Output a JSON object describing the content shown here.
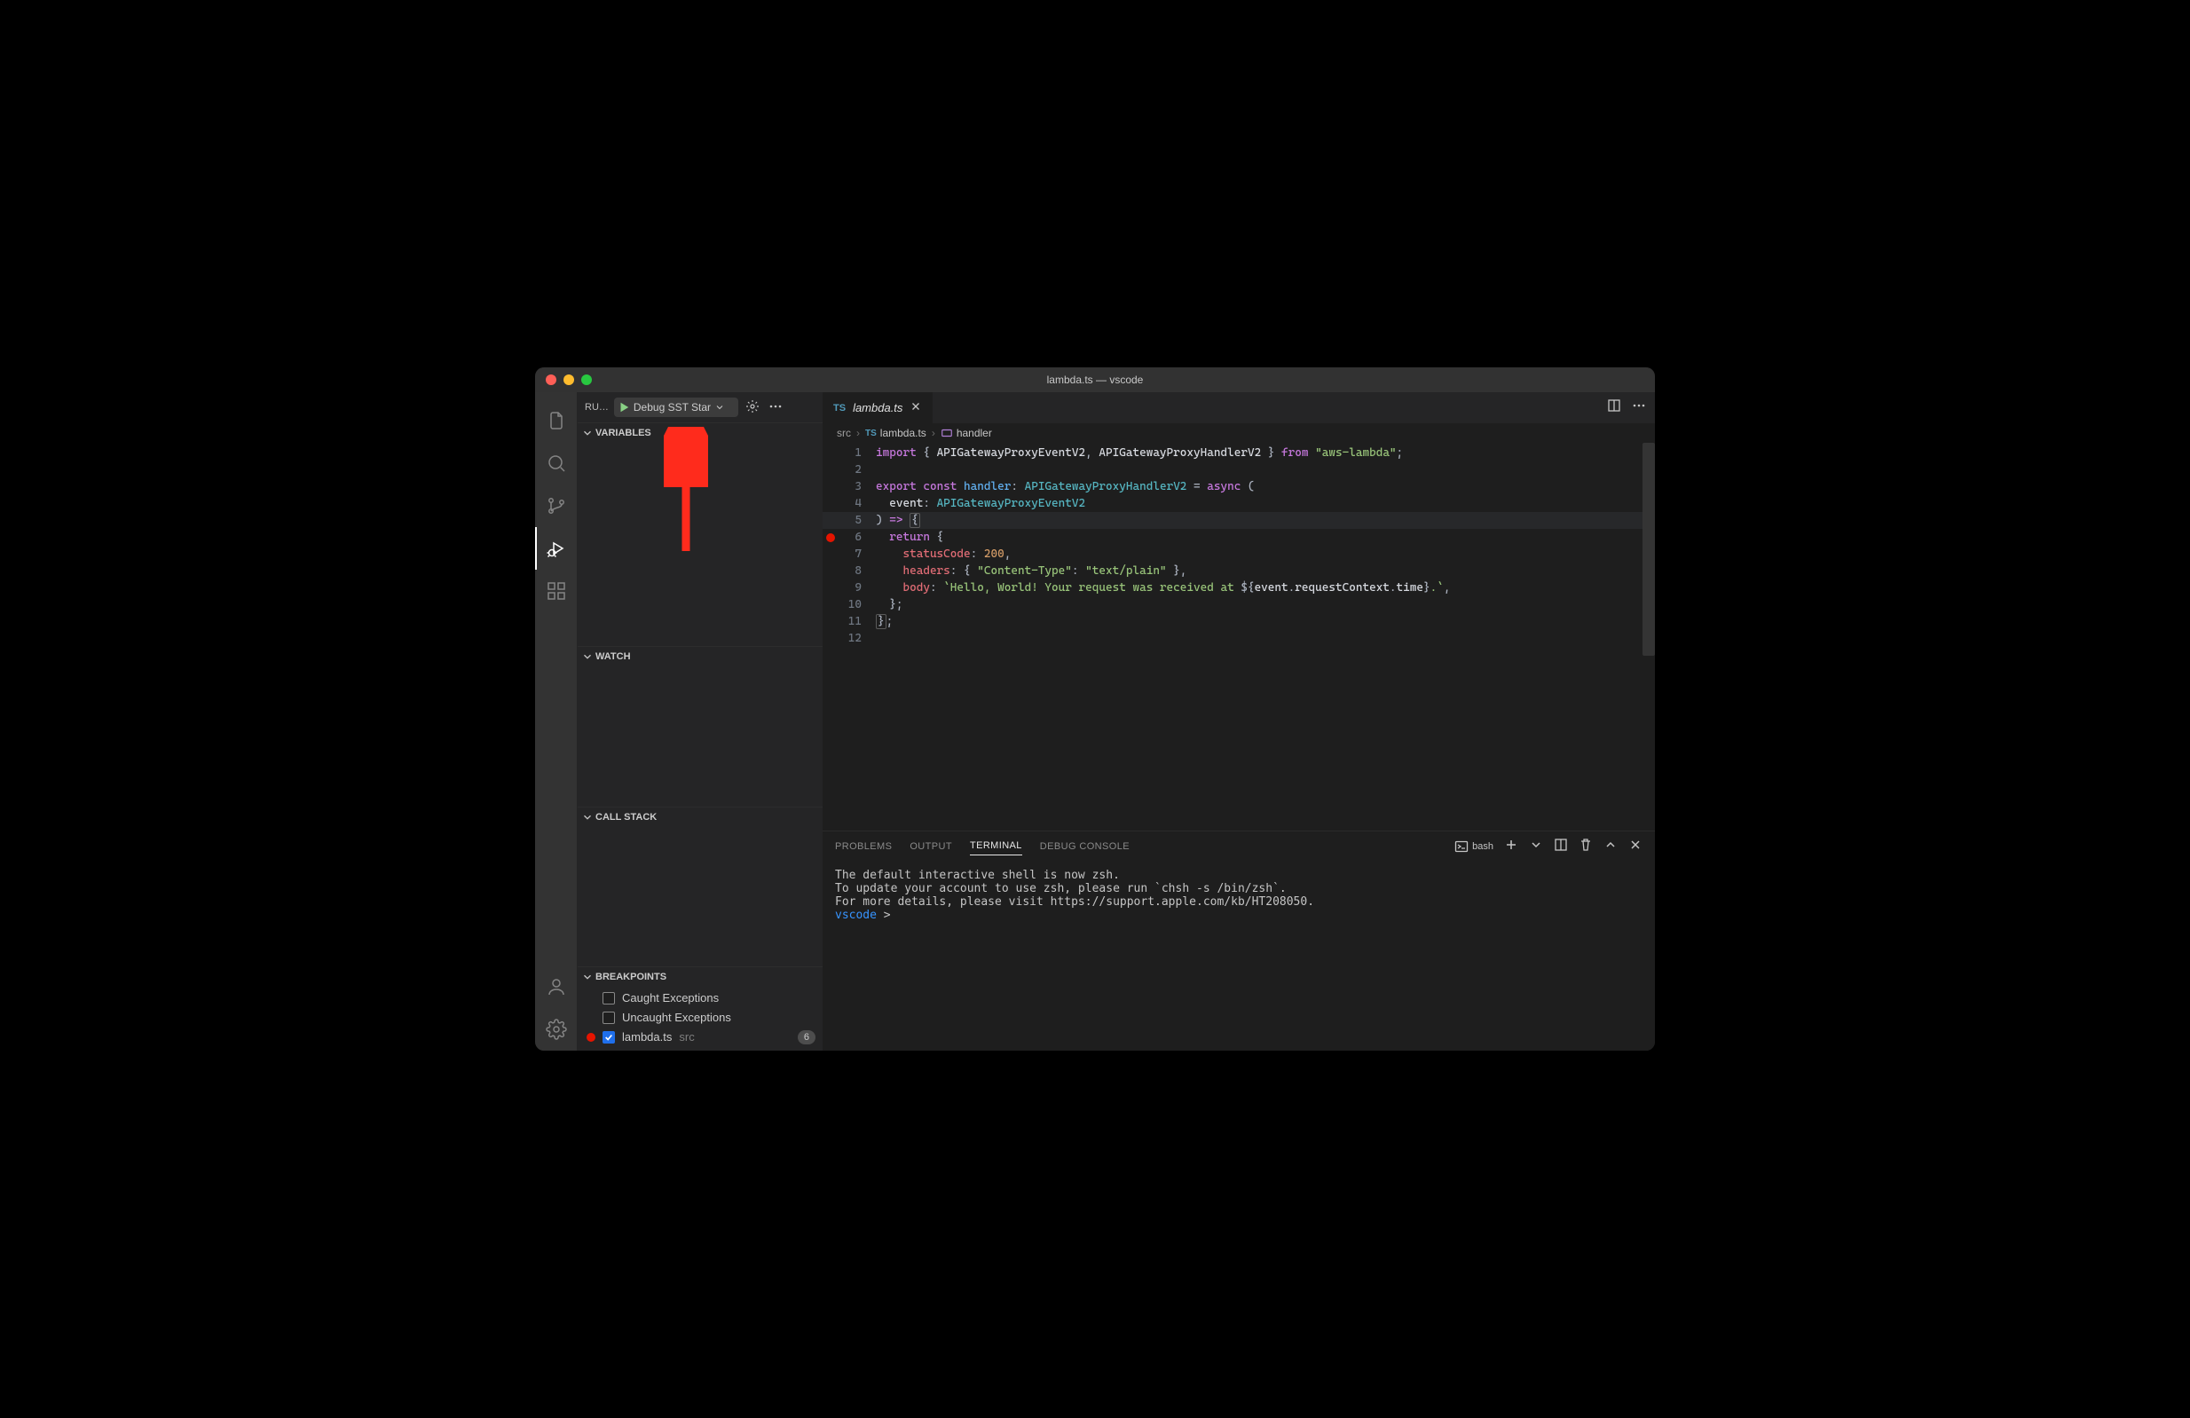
{
  "window": {
    "title": "lambda.ts — vscode"
  },
  "activity": {
    "items": [
      "explorer",
      "search",
      "scm",
      "debug",
      "extensions"
    ],
    "active": "debug",
    "bottom": [
      "account",
      "settings"
    ]
  },
  "debugSidebar": {
    "headerLabel": "RU…",
    "launchConfig": "Debug SST Star",
    "sections": {
      "variables": "VARIABLES",
      "watch": "WATCH",
      "callStack": "CALL STACK",
      "breakpoints": "BREAKPOINTS"
    },
    "breakpoints": {
      "caught": {
        "label": "Caught Exceptions",
        "checked": false
      },
      "uncaught": {
        "label": "Uncaught Exceptions",
        "checked": false
      },
      "items": [
        {
          "file": "lambda.ts",
          "folder": "src",
          "line": 6,
          "enabled": true
        }
      ]
    }
  },
  "tabs": {
    "open": [
      {
        "name": "lambda.ts",
        "lang": "TS"
      }
    ],
    "activeIndex": 0
  },
  "breadcrumbs": {
    "parts": [
      {
        "text": "src",
        "kind": "folder"
      },
      {
        "text": "lambda.ts",
        "kind": "file",
        "badge": "TS"
      },
      {
        "text": "handler",
        "kind": "symbol",
        "icon": "method"
      }
    ]
  },
  "editor": {
    "cursorLine": 5,
    "lines": [
      {
        "n": 1,
        "tokens": [
          [
            "key",
            "import"
          ],
          [
            "punc",
            " { "
          ],
          [
            "id",
            "APIGatewayProxyEventV2"
          ],
          [
            "punc",
            ", "
          ],
          [
            "id",
            "APIGatewayProxyHandlerV2"
          ],
          [
            "punc",
            " } "
          ],
          [
            "key",
            "from"
          ],
          [
            "punc",
            " "
          ],
          [
            "str",
            "\"aws-lambda\""
          ],
          [
            "punc",
            ";"
          ]
        ]
      },
      {
        "n": 2,
        "tokens": []
      },
      {
        "n": 3,
        "tokens": [
          [
            "key",
            "export"
          ],
          [
            "punc",
            " "
          ],
          [
            "key",
            "const"
          ],
          [
            "punc",
            " "
          ],
          [
            "fn",
            "handler"
          ],
          [
            "punc",
            ": "
          ],
          [
            "type",
            "APIGatewayProxyHandlerV2"
          ],
          [
            "punc",
            " = "
          ],
          [
            "key",
            "async"
          ],
          [
            "punc",
            " ("
          ]
        ]
      },
      {
        "n": 4,
        "tokens": [
          [
            "punc",
            "  "
          ],
          [
            "id",
            "event"
          ],
          [
            "punc",
            ": "
          ],
          [
            "type",
            "APIGatewayProxyEventV2"
          ]
        ]
      },
      {
        "n": 5,
        "tokens": [
          [
            "punc",
            ") "
          ],
          [
            "key",
            "=>"
          ],
          [
            "punc",
            " "
          ],
          [
            "box",
            "{"
          ]
        ]
      },
      {
        "n": 6,
        "breakpoint": true,
        "tokens": [
          [
            "punc",
            "  "
          ],
          [
            "key",
            "return"
          ],
          [
            "punc",
            " {"
          ]
        ]
      },
      {
        "n": 7,
        "tokens": [
          [
            "punc",
            "    "
          ],
          [
            "prop",
            "statusCode"
          ],
          [
            "punc",
            ": "
          ],
          [
            "num",
            "200"
          ],
          [
            "punc",
            ","
          ]
        ]
      },
      {
        "n": 8,
        "tokens": [
          [
            "punc",
            "    "
          ],
          [
            "prop",
            "headers"
          ],
          [
            "punc",
            ": { "
          ],
          [
            "str",
            "\"Content-Type\""
          ],
          [
            "punc",
            ": "
          ],
          [
            "str",
            "\"text/plain\""
          ],
          [
            "punc",
            " },"
          ]
        ]
      },
      {
        "n": 9,
        "tokens": [
          [
            "punc",
            "    "
          ],
          [
            "prop",
            "body"
          ],
          [
            "punc",
            ": "
          ],
          [
            "str",
            "`Hello, World! Your request was received at "
          ],
          [
            "punc",
            "${"
          ],
          [
            "id",
            "event"
          ],
          [
            "punc",
            "."
          ],
          [
            "id",
            "requestContext"
          ],
          [
            "punc",
            "."
          ],
          [
            "id",
            "time"
          ],
          [
            "punc",
            "}"
          ],
          [
            "str",
            ".`"
          ],
          [
            "punc",
            ","
          ]
        ]
      },
      {
        "n": 10,
        "tokens": [
          [
            "punc",
            "  };"
          ]
        ]
      },
      {
        "n": 11,
        "tokens": [
          [
            "box",
            "}"
          ],
          [
            "punc",
            ";"
          ]
        ]
      },
      {
        "n": 12,
        "tokens": []
      }
    ]
  },
  "panel": {
    "tabs": [
      "PROBLEMS",
      "OUTPUT",
      "TERMINAL",
      "DEBUG CONSOLE"
    ],
    "active": 2,
    "terminal": {
      "shellName": "bash",
      "lines": [
        "The default interactive shell is now zsh.",
        "To update your account to use zsh, please run `chsh -s /bin/zsh`.",
        "For more details, please visit https://support.apple.com/kb/HT208050."
      ],
      "promptHost": "vscode",
      "promptChar": ">"
    }
  }
}
